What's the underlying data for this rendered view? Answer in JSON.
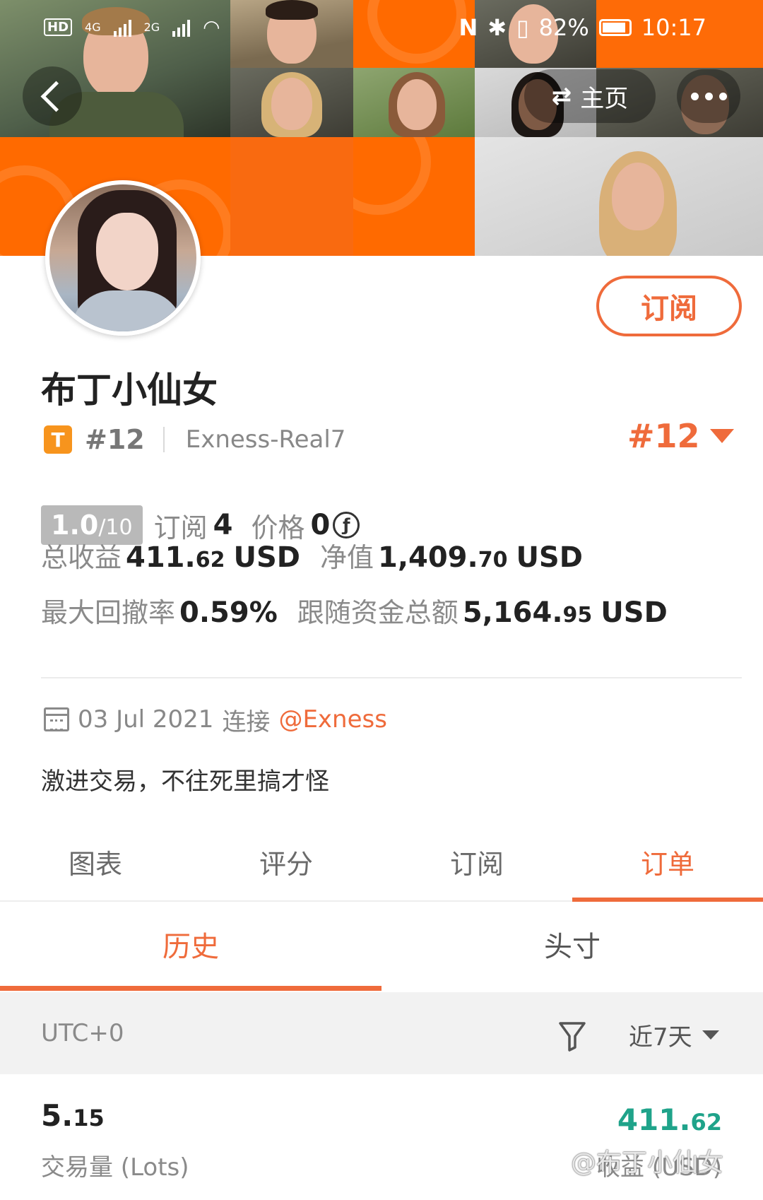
{
  "status_bar": {
    "left_hd": "HD",
    "net1": "4G",
    "net2": "2G",
    "battery": "82%",
    "time": "10:17"
  },
  "nav": {
    "home_label": "主页",
    "swap_glyph": "⇄"
  },
  "profile": {
    "subscribe_label": "订阅",
    "name": "布丁小仙女",
    "badge": "T",
    "rank": "#12",
    "server": "Exness-Real7",
    "rank_right": "#12",
    "score_value": "1.0",
    "score_max": "/10",
    "subscribe_count_label": "订阅",
    "subscribe_count": "4",
    "price_label": "价格",
    "price_value": "0",
    "price_currency_glyph": "ƒ",
    "total_profit_label": "总收益",
    "total_profit_int": "411.",
    "total_profit_dec": "62",
    "total_profit_unit": "USD",
    "equity_label": "净值",
    "equity_int": "1,409.",
    "equity_dec": "70",
    "equity_unit": "USD",
    "drawdown_label": "最大回撤率",
    "drawdown_value": "0.59%",
    "follow_label": "跟随资金总额",
    "follow_int": "5,164.",
    "follow_dec": "95",
    "follow_unit": "USD",
    "join_date": "03 Jul 2021",
    "join_text": "连接",
    "broker": "@Exness",
    "bio": "激进交易，不往死里搞才怪"
  },
  "tabs": [
    {
      "label": "图表"
    },
    {
      "label": "评分"
    },
    {
      "label": "订阅"
    },
    {
      "label": "订单"
    }
  ],
  "active_tab": "订单",
  "subtabs": [
    {
      "label": "历史"
    },
    {
      "label": "头寸"
    }
  ],
  "active_subtab": "历史",
  "filter": {
    "timezone": "UTC+0",
    "period": "近7天"
  },
  "summary": {
    "lots_int": "5.",
    "lots_dec": "15",
    "lots_label": "交易量 (Lots)",
    "profit_int": "411.",
    "profit_dec": "62",
    "profit_label": "收益 (USD)",
    "profit_color": "#1fa38a",
    "watermark": "@布丁小仙女"
  },
  "colors": {
    "accent": "#ef6b3b",
    "header_orange": "#ff6a00",
    "positive": "#1fa38a"
  }
}
